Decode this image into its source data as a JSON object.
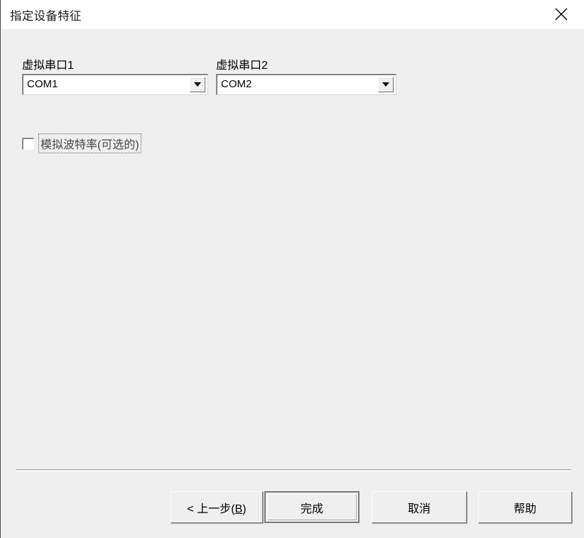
{
  "window": {
    "title": "指定设备特征",
    "close_icon": "close-icon"
  },
  "form": {
    "port1": {
      "label": "虚拟串口1",
      "value": "COM1",
      "arrow_icon": "chevron-down-icon"
    },
    "port2": {
      "label": "虚拟串口2",
      "value": "COM2",
      "arrow_icon": "chevron-down-icon"
    },
    "baudrate_checkbox": {
      "label": "模拟波特率(可选的)",
      "checked": false
    }
  },
  "buttons": {
    "back": {
      "prefix": "< ",
      "text": "上一步(",
      "accel": "B",
      "suffix": ")"
    },
    "finish": "完成",
    "cancel": "取消",
    "help": "帮助"
  },
  "colors": {
    "dialog_background": "#efefef",
    "titlebar_background": "#ffffff",
    "field_background": "#ffffff",
    "text": "#000000",
    "border": "#7d7d7d"
  }
}
